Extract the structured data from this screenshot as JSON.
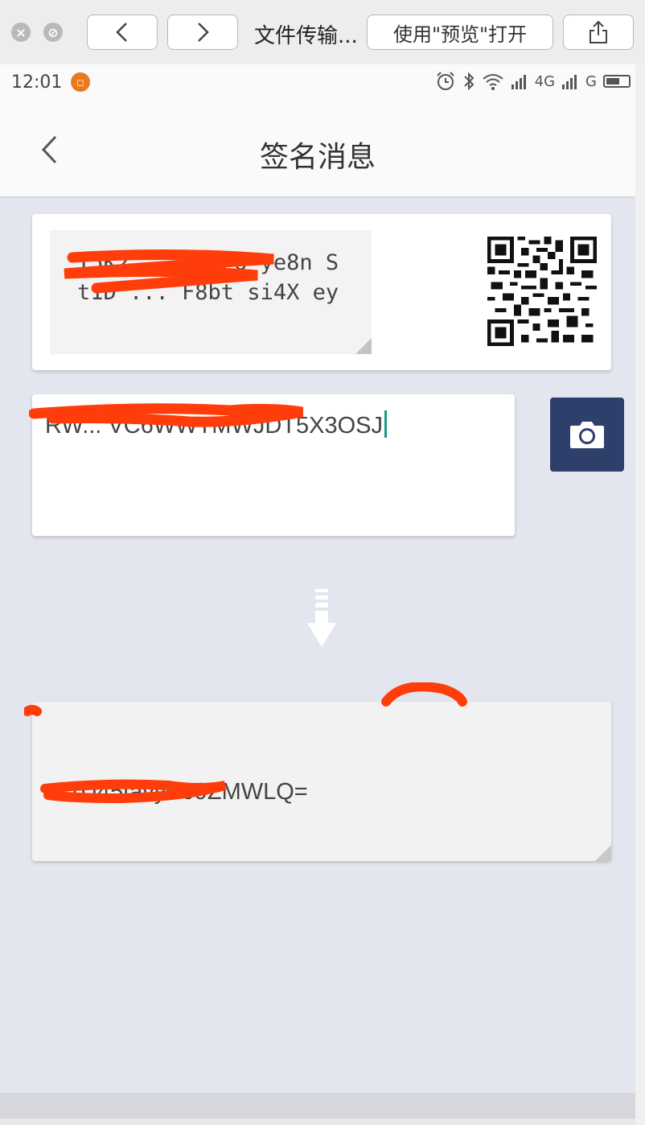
{
  "browser": {
    "title": "文件传输...",
    "open_with_label": "使用\"预览\"打开",
    "close_glyph": "×",
    "stop_glyph": "⊘"
  },
  "status_bar": {
    "time": "12:01",
    "network_left": "4G",
    "network_right": "G"
  },
  "nav": {
    "title": "签名消息"
  },
  "message_card": {
    "text": "T5K2 ... t6Po ye8n St1D ... F8bt si4X ey"
  },
  "address_input": {
    "value": "RW... VC6WWTMWJDT5X3OSJ"
  },
  "signature_output": {
    "value": "... oJ45tavywJ9ZMWLQ="
  },
  "colors": {
    "accent": "#2f3f6b",
    "cursor": "#169b8a",
    "redaction": "#ff3d0a",
    "background": "#e3e6ee"
  },
  "icons": {
    "back": "chevron-left-icon",
    "camera": "camera-icon",
    "arrow": "arrow-down-icon",
    "qr": "qr-code-icon"
  }
}
